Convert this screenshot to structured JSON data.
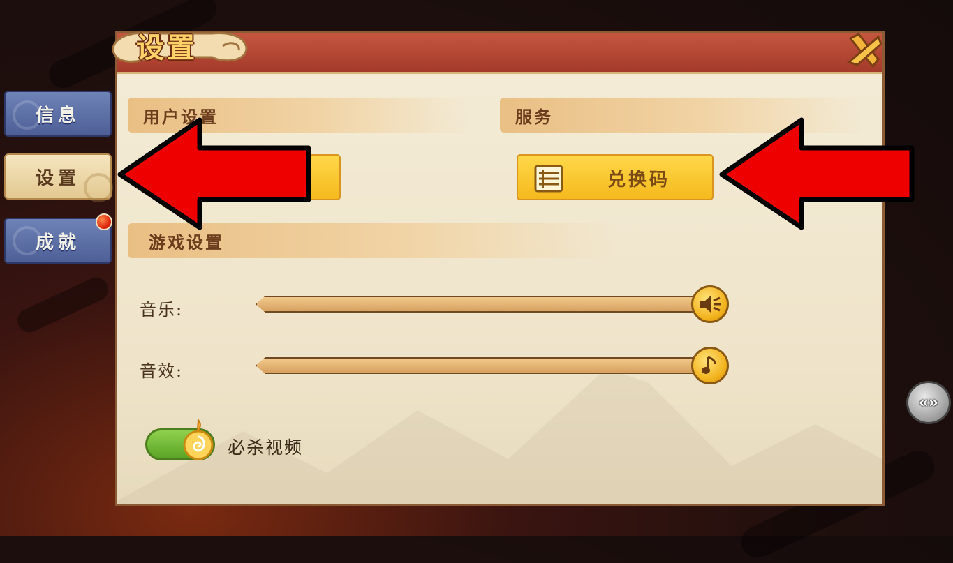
{
  "sidebar": {
    "items": [
      {
        "label": "信息",
        "active": false
      },
      {
        "label": "设置",
        "active": true
      },
      {
        "label": "成就",
        "active": false,
        "has_badge": true
      }
    ]
  },
  "dialog": {
    "title": "设置",
    "sections": {
      "user": {
        "title": "用户设置"
      },
      "service": {
        "title": "服务",
        "redeem_button": "兑换码"
      },
      "game": {
        "title": "游戏设置"
      }
    },
    "settings": {
      "music": {
        "label": "音乐:",
        "level": 1.0
      },
      "sfx": {
        "label": "音效:",
        "level": 1.0
      },
      "ult_video": {
        "label": "必杀视频",
        "enabled": true
      }
    }
  },
  "side_handle": {
    "label": "«»"
  },
  "colors": {
    "header_red": "#a43a2a",
    "panel_bg": "#f1e7cf",
    "gold_button": "#f5b91d",
    "tab_blue": "#5a6ea6",
    "annotation_arrow": "#ee0000"
  },
  "icons": [
    "close-icon",
    "list-icon",
    "speaker-icon",
    "music-note-icon",
    "flame-icon",
    "swirl-icon"
  ]
}
